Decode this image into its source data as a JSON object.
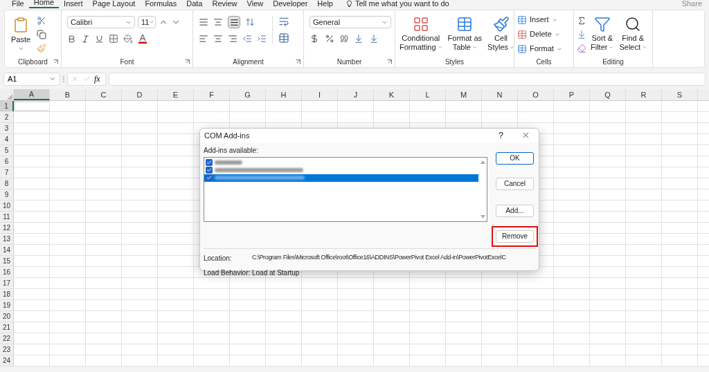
{
  "menu_tabs": [
    {
      "label": "File",
      "selected": false
    },
    {
      "label": "Home",
      "selected": true
    },
    {
      "label": "Insert",
      "selected": false
    },
    {
      "label": "Page Layout",
      "selected": false
    },
    {
      "label": "Formulas",
      "selected": false
    },
    {
      "label": "Data",
      "selected": false
    },
    {
      "label": "Review",
      "selected": false
    },
    {
      "label": "View",
      "selected": false
    },
    {
      "label": "Developer",
      "selected": false
    },
    {
      "label": "Help",
      "selected": false
    }
  ],
  "tell_me": "Tell me what you want to do",
  "share": "Share",
  "ribbon": {
    "clipboard": {
      "paste": "Paste",
      "label": "Clipboard"
    },
    "font": {
      "font_name": "Calibri",
      "font_size": "11",
      "label": "Font"
    },
    "alignment": {
      "label": "Alignment",
      "bottom_align_selected": true
    },
    "number": {
      "format": "General",
      "label": "Number"
    },
    "styles": {
      "buttons": [
        {
          "line1": "Conditional",
          "line2": "Formatting"
        },
        {
          "line1": "Format as",
          "line2": "Table"
        },
        {
          "line1": "Cell",
          "line2": "Styles"
        }
      ],
      "label": "Styles"
    },
    "cells": {
      "buttons": [
        "Insert",
        "Delete",
        "Format"
      ],
      "label": "Cells"
    },
    "editing": {
      "buttons": [
        {
          "line1": "Sort &",
          "line2": "Filter"
        },
        {
          "line1": "Find &",
          "line2": "Select"
        }
      ],
      "label": "Editing"
    }
  },
  "name_box": "A1",
  "fx": "fx",
  "columns": [
    {
      "label": "A",
      "selected": true
    },
    {
      "label": "B",
      "selected": false
    },
    {
      "label": "C",
      "selected": false
    },
    {
      "label": "D",
      "selected": false
    },
    {
      "label": "E",
      "selected": false
    },
    {
      "label": "F",
      "selected": false
    },
    {
      "label": "G",
      "selected": false
    },
    {
      "label": "H",
      "selected": false
    },
    {
      "label": "I",
      "selected": false
    },
    {
      "label": "J",
      "selected": false
    },
    {
      "label": "K",
      "selected": false
    },
    {
      "label": "L",
      "selected": false
    },
    {
      "label": "M",
      "selected": false
    },
    {
      "label": "N",
      "selected": false
    },
    {
      "label": "O",
      "selected": false
    },
    {
      "label": "P",
      "selected": false
    },
    {
      "label": "Q",
      "selected": false
    },
    {
      "label": "R",
      "selected": false
    },
    {
      "label": "S",
      "selected": false
    }
  ],
  "rows": [
    {
      "label": "1",
      "selected": true
    },
    {
      "label": "2",
      "selected": false
    },
    {
      "label": "3",
      "selected": false
    },
    {
      "label": "4",
      "selected": false
    },
    {
      "label": "5",
      "selected": false
    },
    {
      "label": "6",
      "selected": false
    },
    {
      "label": "7",
      "selected": false
    },
    {
      "label": "8",
      "selected": false
    },
    {
      "label": "9",
      "selected": false
    },
    {
      "label": "10",
      "selected": false
    },
    {
      "label": "11",
      "selected": false
    },
    {
      "label": "12",
      "selected": false
    },
    {
      "label": "13",
      "selected": false
    },
    {
      "label": "14",
      "selected": false
    },
    {
      "label": "15",
      "selected": false
    },
    {
      "label": "16",
      "selected": false
    },
    {
      "label": "17",
      "selected": false
    },
    {
      "label": "18",
      "selected": false
    },
    {
      "label": "19",
      "selected": false
    },
    {
      "label": "20",
      "selected": false
    },
    {
      "label": "21",
      "selected": false
    },
    {
      "label": "22",
      "selected": false
    },
    {
      "label": "23",
      "selected": false
    },
    {
      "label": "24",
      "selected": false
    }
  ],
  "dialog": {
    "title": "COM Add-ins",
    "help": "?",
    "list_label": "Add-ins available:",
    "items": [
      {
        "checked": true,
        "selected": false
      },
      {
        "checked": true,
        "selected": false
      },
      {
        "checked": true,
        "selected": true
      }
    ],
    "buttons": [
      {
        "label": "OK",
        "default": true,
        "highlighted": false
      },
      {
        "label": "Cancel",
        "default": false,
        "highlighted": false
      },
      {
        "label": "Add...",
        "default": false,
        "highlighted": false
      },
      {
        "label": "Remove",
        "default": false,
        "highlighted": true
      }
    ],
    "location_label": "Location:",
    "location": "C:\\Program Files\\Microsoft Office\\root\\Office16\\ADDINS\\PowerPivot Excel Add-in\\PowerPivotExcelC",
    "behavior_label": "Load Behavior:",
    "behavior": "Load at Startup"
  }
}
